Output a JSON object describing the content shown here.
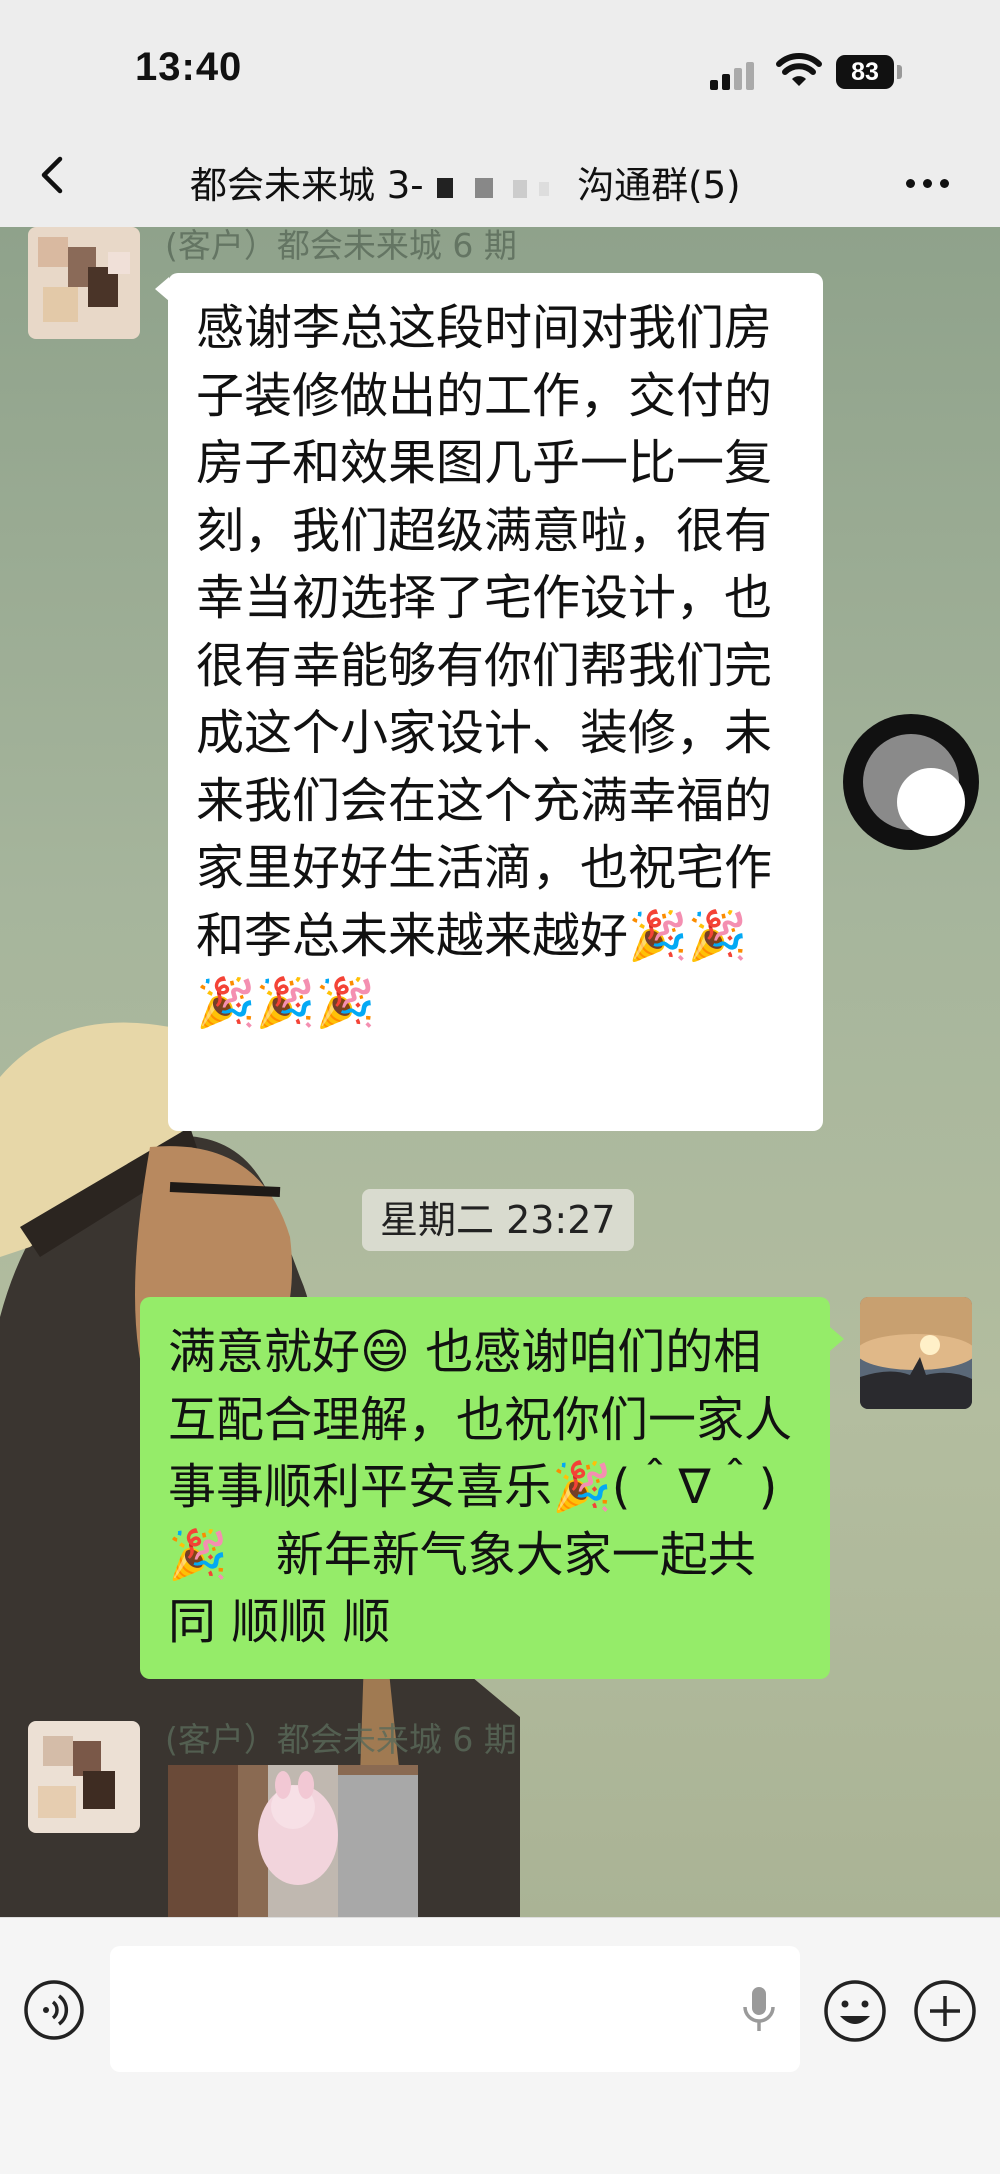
{
  "status_bar": {
    "time": "13:40",
    "battery": "83"
  },
  "header": {
    "title_prefix": "都会未来城 3-",
    "title_suffix": "沟通群(5)"
  },
  "messages": [
    {
      "sender": "(客户）都会未来城 6 期",
      "side": "left",
      "text": "感谢李总这段时间对我们房子装修做出的工作，交付的房子和效果图几乎一比一复刻，我们超级满意啦，很有幸当初选择了宅作设计，也很有幸能够有你们帮我们完成这个小家设计、装修，未来我们会在这个充满幸福的家里好好生活滴，也祝宅作和李总未来越来越好🎉🎉🎉🎉🎉"
    },
    {
      "timestamp": "星期二 23:27"
    },
    {
      "side": "right",
      "text": "满意就好😄 也感谢咱们的相互配合理解，也祝你们一家人事事顺利平安喜乐🎉(＾∇＾)🎉　新年新气象大家一起共同 顺顺 顺"
    },
    {
      "sender": "(客户）都会未来城 6 期",
      "side": "left",
      "type": "image"
    }
  ],
  "colors": {
    "self_bubble": "#95ec69",
    "other_bubble": "#ffffff"
  },
  "icons": [
    "back-arrow-icon",
    "more-icon",
    "voice-icon",
    "microphone-icon",
    "emoji-icon",
    "plus-icon"
  ]
}
